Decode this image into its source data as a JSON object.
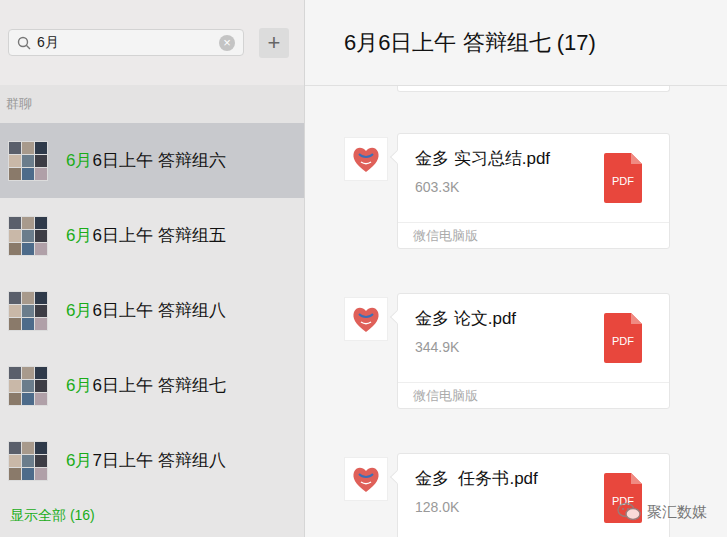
{
  "search": {
    "query": "6月",
    "clear": "×",
    "add": "+"
  },
  "sidebar": {
    "section": "群聊",
    "items": [
      {
        "match": "6月",
        "rest": "6日上午 答辩组六",
        "selected": true
      },
      {
        "match": "6月",
        "rest": "6日上午 答辩组五",
        "selected": false
      },
      {
        "match": "6月",
        "rest": "6日上午 答辩组八",
        "selected": false
      },
      {
        "match": "6月",
        "rest": "6日上午 答辩组七",
        "selected": false
      },
      {
        "match": "6月",
        "rest": "7日上午 答辩组八",
        "selected": false
      }
    ],
    "show_all": "显示全部 (16)"
  },
  "chat": {
    "title": "6月6日上午 答辩组七 (17)",
    "messages": [
      {
        "file": "金多 实习总结.pdf",
        "size": "603.3K",
        "badge": "PDF",
        "footer": "微信电脑版"
      },
      {
        "file": "金多 论文.pdf",
        "size": "344.9K",
        "badge": "PDF",
        "footer": "微信电脑版"
      },
      {
        "file": "金多  任务书.pdf",
        "size": "128.0K",
        "badge": "PDF"
      }
    ]
  },
  "watermark": "聚汇数媒"
}
